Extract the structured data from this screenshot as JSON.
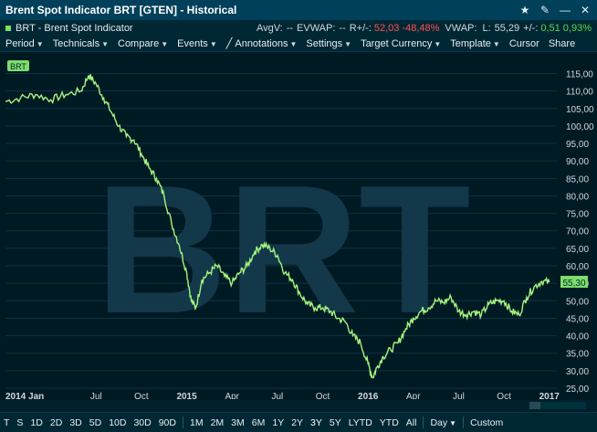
{
  "window": {
    "title": "Brent Spot Indicator BRT [GTEN] - Historical",
    "buttons": {
      "star": "★",
      "edit": "✎",
      "minimize": "—",
      "close": "✕"
    }
  },
  "infobar": {
    "instrument": "BRT - Brent Spot Indicator",
    "avgv_label": "AvgV:",
    "avgv_value": "--",
    "evwap_label": "EVWAP:",
    "evwap_value": "--",
    "rplus_label": "R+/-:",
    "rplus_value": "52,03",
    "rplus_pct": "-48,48%",
    "vwap_label": "VWAP:",
    "last_label": "L:",
    "last_value": "55,29",
    "chg_label": "+/-:",
    "chg_value": "0,51",
    "chg_pct": "0,93%"
  },
  "menu": [
    {
      "label": "Period"
    },
    {
      "label": "Technicals"
    },
    {
      "label": "Compare"
    },
    {
      "label": "Events"
    },
    {
      "label": "Annotations"
    },
    {
      "label": "Settings"
    },
    {
      "label": "Target Currency"
    },
    {
      "label": "Template"
    },
    {
      "label": "Cursor"
    },
    {
      "label": "Share"
    }
  ],
  "periods": [
    "T",
    "S",
    "1D",
    "2D",
    "3D",
    "5D",
    "10D",
    "30D",
    "90D",
    "1M",
    "2M",
    "3M",
    "6M",
    "1Y",
    "2Y",
    "3Y",
    "5Y",
    "LYTD",
    "YTD",
    "All",
    "Day",
    "Custom"
  ],
  "colors": {
    "line": "#a6f57e",
    "watermark": "#12384a",
    "grid": "#0d3340",
    "bg": "#001a24",
    "last_tag": "#7dde6a"
  },
  "chart_data": {
    "type": "line",
    "series": [
      {
        "name": "BRT"
      }
    ],
    "watermark": "BRT",
    "last_price_tag": "55,30",
    "ylim": [
      25,
      118
    ],
    "y_ticks": [
      "115,00",
      "110,00",
      "105,00",
      "100,00",
      "95,00",
      "90,00",
      "85,00",
      "80,00",
      "75,00",
      "70,00",
      "65,00",
      "60,00",
      "55,00",
      "50,00",
      "45,00",
      "40,00",
      "35,00",
      "30,00",
      "25,00"
    ],
    "y_tick_values": [
      115,
      110,
      105,
      100,
      95,
      90,
      85,
      80,
      75,
      70,
      65,
      60,
      55,
      50,
      45,
      40,
      35,
      30,
      25
    ],
    "x_ticks": [
      "2014 Jan",
      "Jul",
      "Oct",
      "2015",
      "Apr",
      "Jul",
      "Oct",
      "2016",
      "Apr",
      "Jul",
      "Oct",
      "2017"
    ],
    "x_tick_months": [
      0,
      6,
      9,
      12,
      15,
      18,
      21,
      24,
      27,
      30,
      33,
      36
    ],
    "points": [
      [
        0,
        107
      ],
      [
        1,
        108
      ],
      [
        2,
        109
      ],
      [
        3,
        107.5
      ],
      [
        4,
        109
      ],
      [
        5,
        110
      ],
      [
        5.5,
        114.5
      ],
      [
        6,
        112
      ],
      [
        6.5,
        108
      ],
      [
        7,
        104
      ],
      [
        7.5,
        100
      ],
      [
        8,
        97
      ],
      [
        8.5,
        96
      ],
      [
        9,
        92
      ],
      [
        9.5,
        88
      ],
      [
        10,
        85
      ],
      [
        10.5,
        80
      ],
      [
        11,
        72
      ],
      [
        11.5,
        66
      ],
      [
        12,
        58
      ],
      [
        12.3,
        50
      ],
      [
        12.6,
        48
      ],
      [
        13,
        56
      ],
      [
        13.5,
        58
      ],
      [
        14,
        60
      ],
      [
        14.5,
        57
      ],
      [
        15,
        55
      ],
      [
        15.5,
        58
      ],
      [
        16,
        60
      ],
      [
        16.5,
        64
      ],
      [
        17,
        66
      ],
      [
        17.5,
        65
      ],
      [
        18,
        63
      ],
      [
        18.5,
        58
      ],
      [
        19,
        56
      ],
      [
        19.5,
        52
      ],
      [
        20,
        49
      ],
      [
        20.5,
        48
      ],
      [
        21,
        48
      ],
      [
        21.5,
        47
      ],
      [
        22,
        45
      ],
      [
        22.5,
        44
      ],
      [
        23,
        40
      ],
      [
        23.5,
        38
      ],
      [
        24,
        32
      ],
      [
        24.3,
        28
      ],
      [
        24.6,
        31
      ],
      [
        25,
        34
      ],
      [
        25.5,
        36
      ],
      [
        26,
        38
      ],
      [
        26.5,
        42
      ],
      [
        27,
        45
      ],
      [
        27.5,
        47
      ],
      [
        28,
        48
      ],
      [
        28.5,
        50
      ],
      [
        29,
        49.5
      ],
      [
        29.5,
        51
      ],
      [
        30,
        47
      ],
      [
        30.5,
        46
      ],
      [
        31,
        47
      ],
      [
        31.5,
        46
      ],
      [
        32,
        49
      ],
      [
        32.5,
        50
      ],
      [
        33,
        50
      ],
      [
        33.5,
        47
      ],
      [
        34,
        46
      ],
      [
        34.5,
        51
      ],
      [
        35,
        54
      ],
      [
        35.5,
        55.5
      ],
      [
        36,
        55.3
      ]
    ]
  }
}
